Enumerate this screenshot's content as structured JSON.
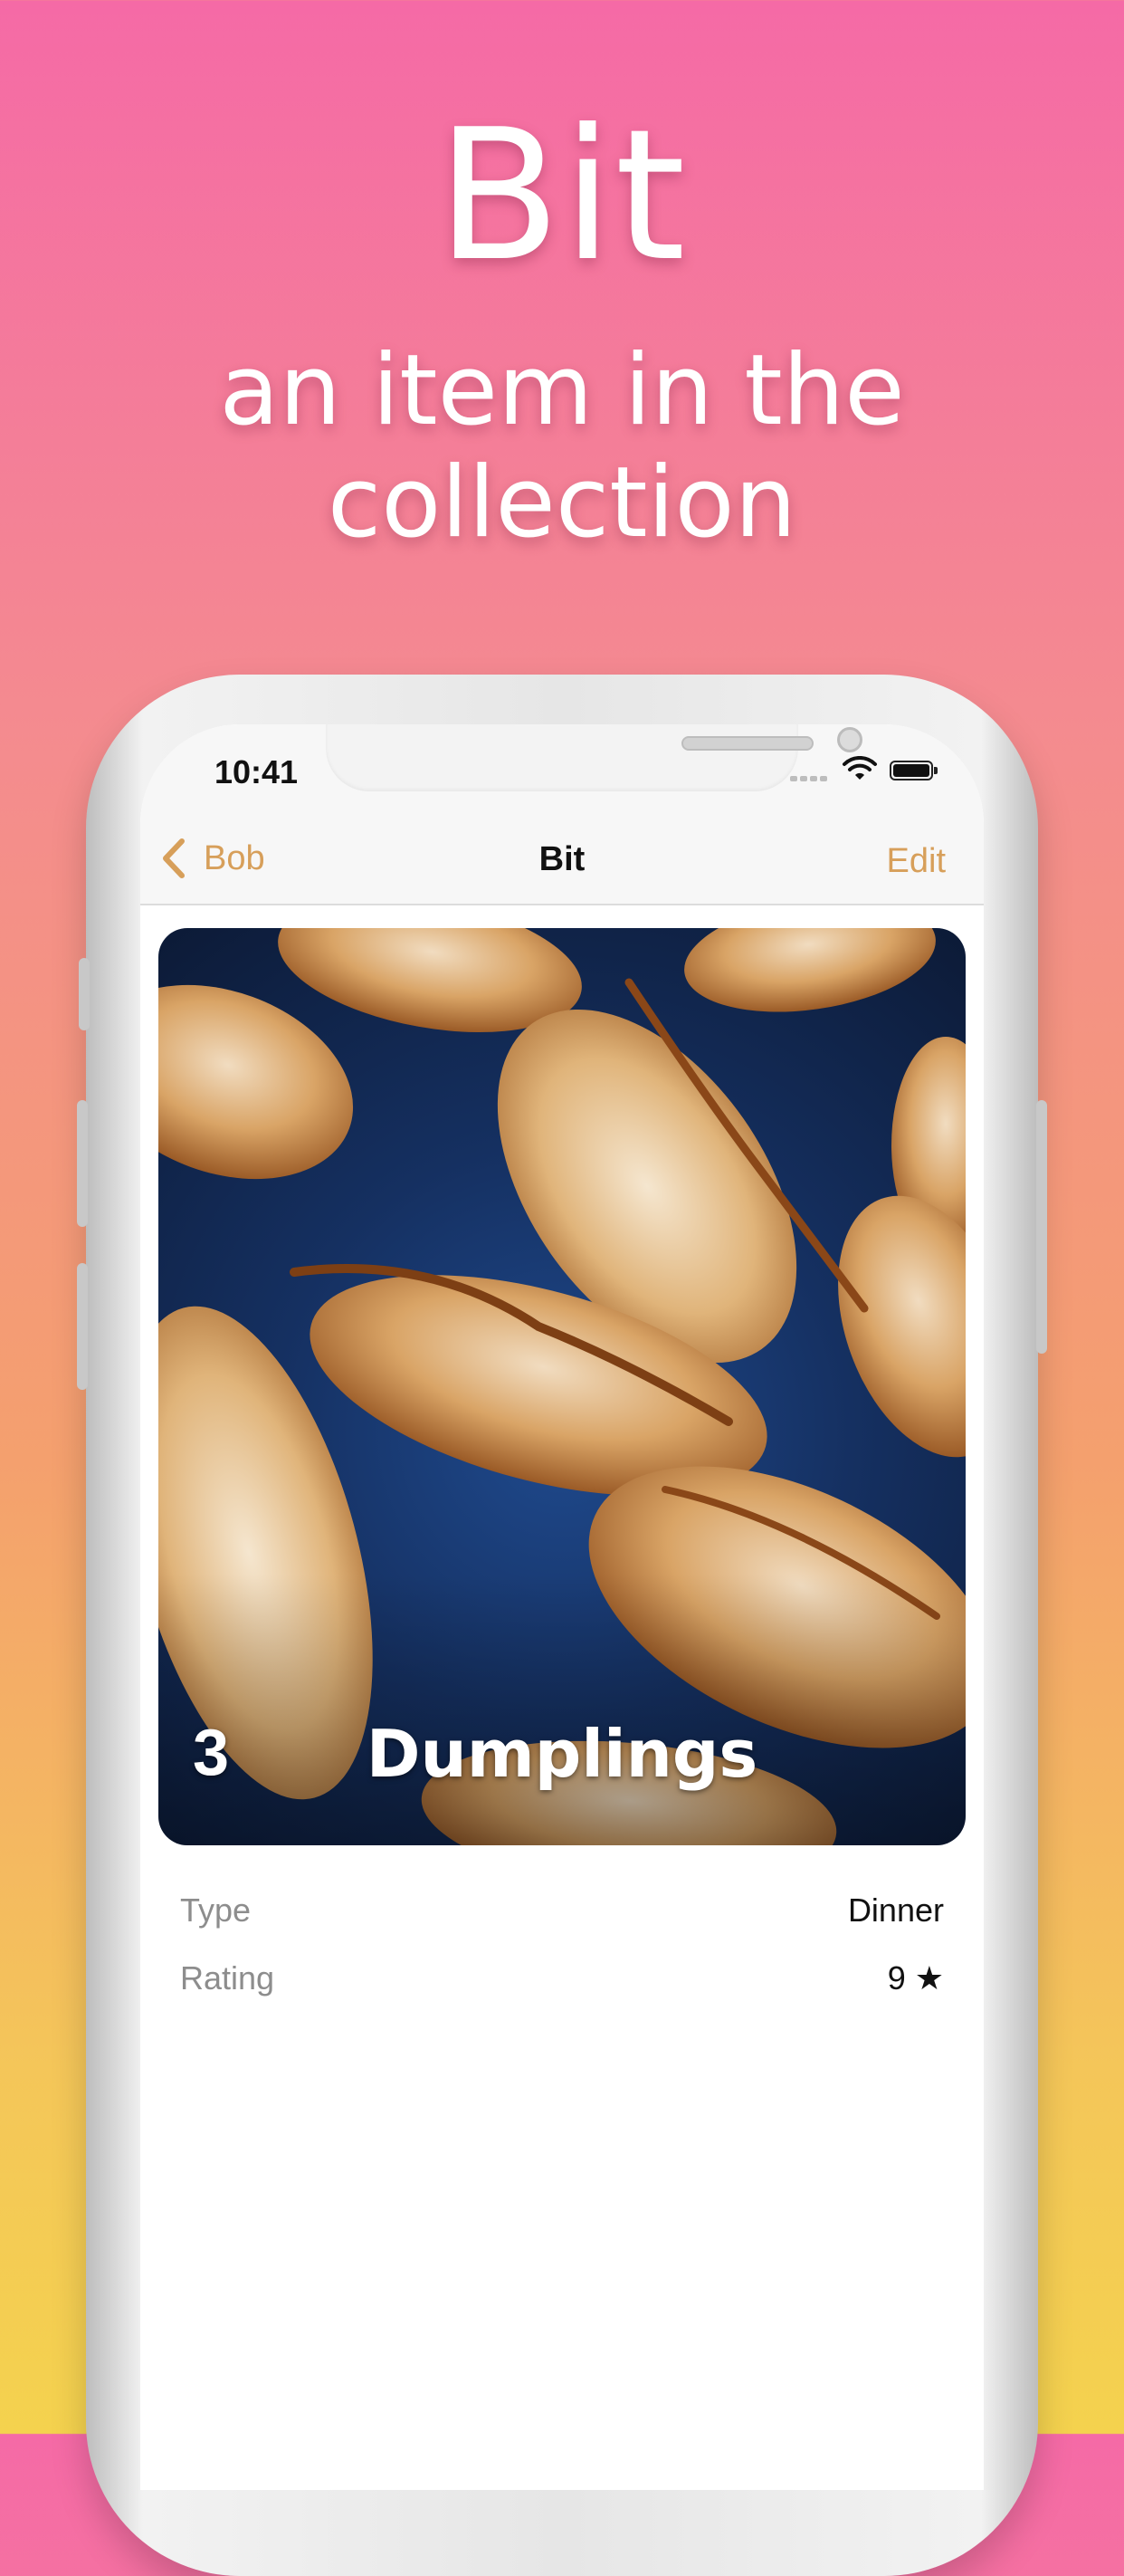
{
  "promo": {
    "title": "Bit",
    "subtitle": "an item in the collection"
  },
  "status_bar": {
    "time": "10:41"
  },
  "nav": {
    "back_label": "Bob",
    "title": "Bit",
    "edit_label": "Edit"
  },
  "item": {
    "count": "3",
    "name": "Dumplings",
    "image_icon": "dumplings-photo"
  },
  "details": [
    {
      "label": "Type",
      "value": "Dinner"
    },
    {
      "label": "Rating",
      "value": "9 ★"
    }
  ],
  "colors": {
    "accent": "#d79f5a",
    "gradient_top": "#f56aa6",
    "gradient_bottom": "#f4d24e"
  }
}
